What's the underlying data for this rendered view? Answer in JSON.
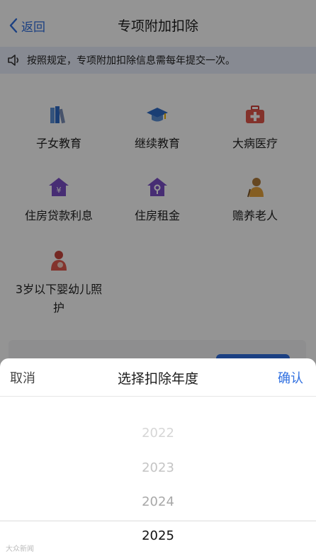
{
  "nav": {
    "back_label": "返回",
    "title": "专项附加扣除"
  },
  "notice": {
    "text": "按照规定，专项附加扣除信息需每年提交一次。"
  },
  "categories": [
    {
      "label": "子女教育",
      "icon": "books-icon"
    },
    {
      "label": "继续教育",
      "icon": "graduation-cap-icon"
    },
    {
      "label": "大病医疗",
      "icon": "medical-kit-icon"
    },
    {
      "label": "住房贷款利息",
      "icon": "house-yuan-icon"
    },
    {
      "label": "住房租金",
      "icon": "house-key-icon"
    },
    {
      "label": "赡养老人",
      "icon": "elderly-person-icon"
    },
    {
      "label": "3岁以下婴幼儿照护",
      "icon": "mother-baby-icon"
    }
  ],
  "picker": {
    "cancel_label": "取消",
    "title": "选择扣除年度",
    "confirm_label": "确认",
    "years": [
      "2022",
      "2023",
      "2024",
      "2025"
    ],
    "selected": "2025"
  },
  "watermark": "大众新闻",
  "colors": {
    "accent": "#2f6fe0",
    "notice_bg": "#e9eefb"
  }
}
